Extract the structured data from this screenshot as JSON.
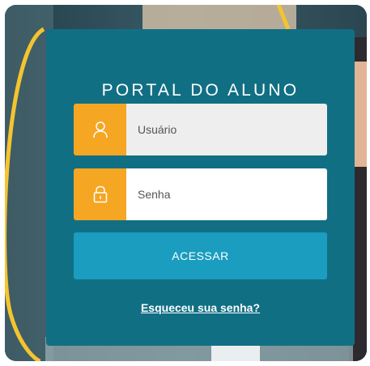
{
  "login": {
    "title": "PORTAL DO ALUNO",
    "username_placeholder": "Usuário",
    "password_placeholder": "Senha",
    "submit_label": "ACESSAR",
    "forgot_label": "Esqueceu sua senha?"
  },
  "icons": {
    "username": "user-icon",
    "password": "lock-icon"
  },
  "colors": {
    "card": "#116f84",
    "accent": "#f5a623",
    "button": "#1a9dbf",
    "decoration": "#f4c430"
  }
}
